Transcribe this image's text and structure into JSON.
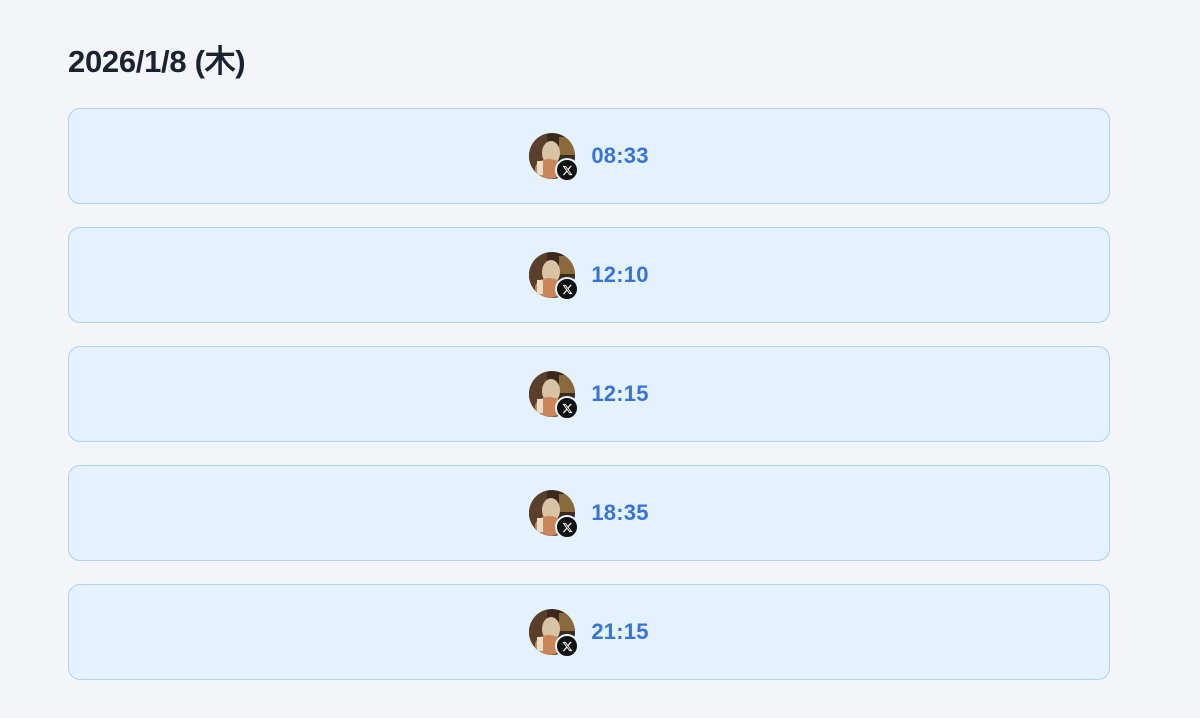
{
  "date_heading": "2026/1/8 (木)",
  "colors": {
    "background": "#f3f5f9",
    "card_background": "#e3f2fe",
    "card_border": "#a9d3f5",
    "time_text": "#3874d8",
    "heading_text": "#1b2230"
  },
  "entries": [
    {
      "time": "08:33",
      "avatar_icon": "user-avatar",
      "badge_icon": "x-logo-icon"
    },
    {
      "time": "12:10",
      "avatar_icon": "user-avatar",
      "badge_icon": "x-logo-icon"
    },
    {
      "time": "12:15",
      "avatar_icon": "user-avatar",
      "badge_icon": "x-logo-icon"
    },
    {
      "time": "18:35",
      "avatar_icon": "user-avatar",
      "badge_icon": "x-logo-icon"
    },
    {
      "time": "21:15",
      "avatar_icon": "user-avatar",
      "badge_icon": "x-logo-icon"
    }
  ]
}
